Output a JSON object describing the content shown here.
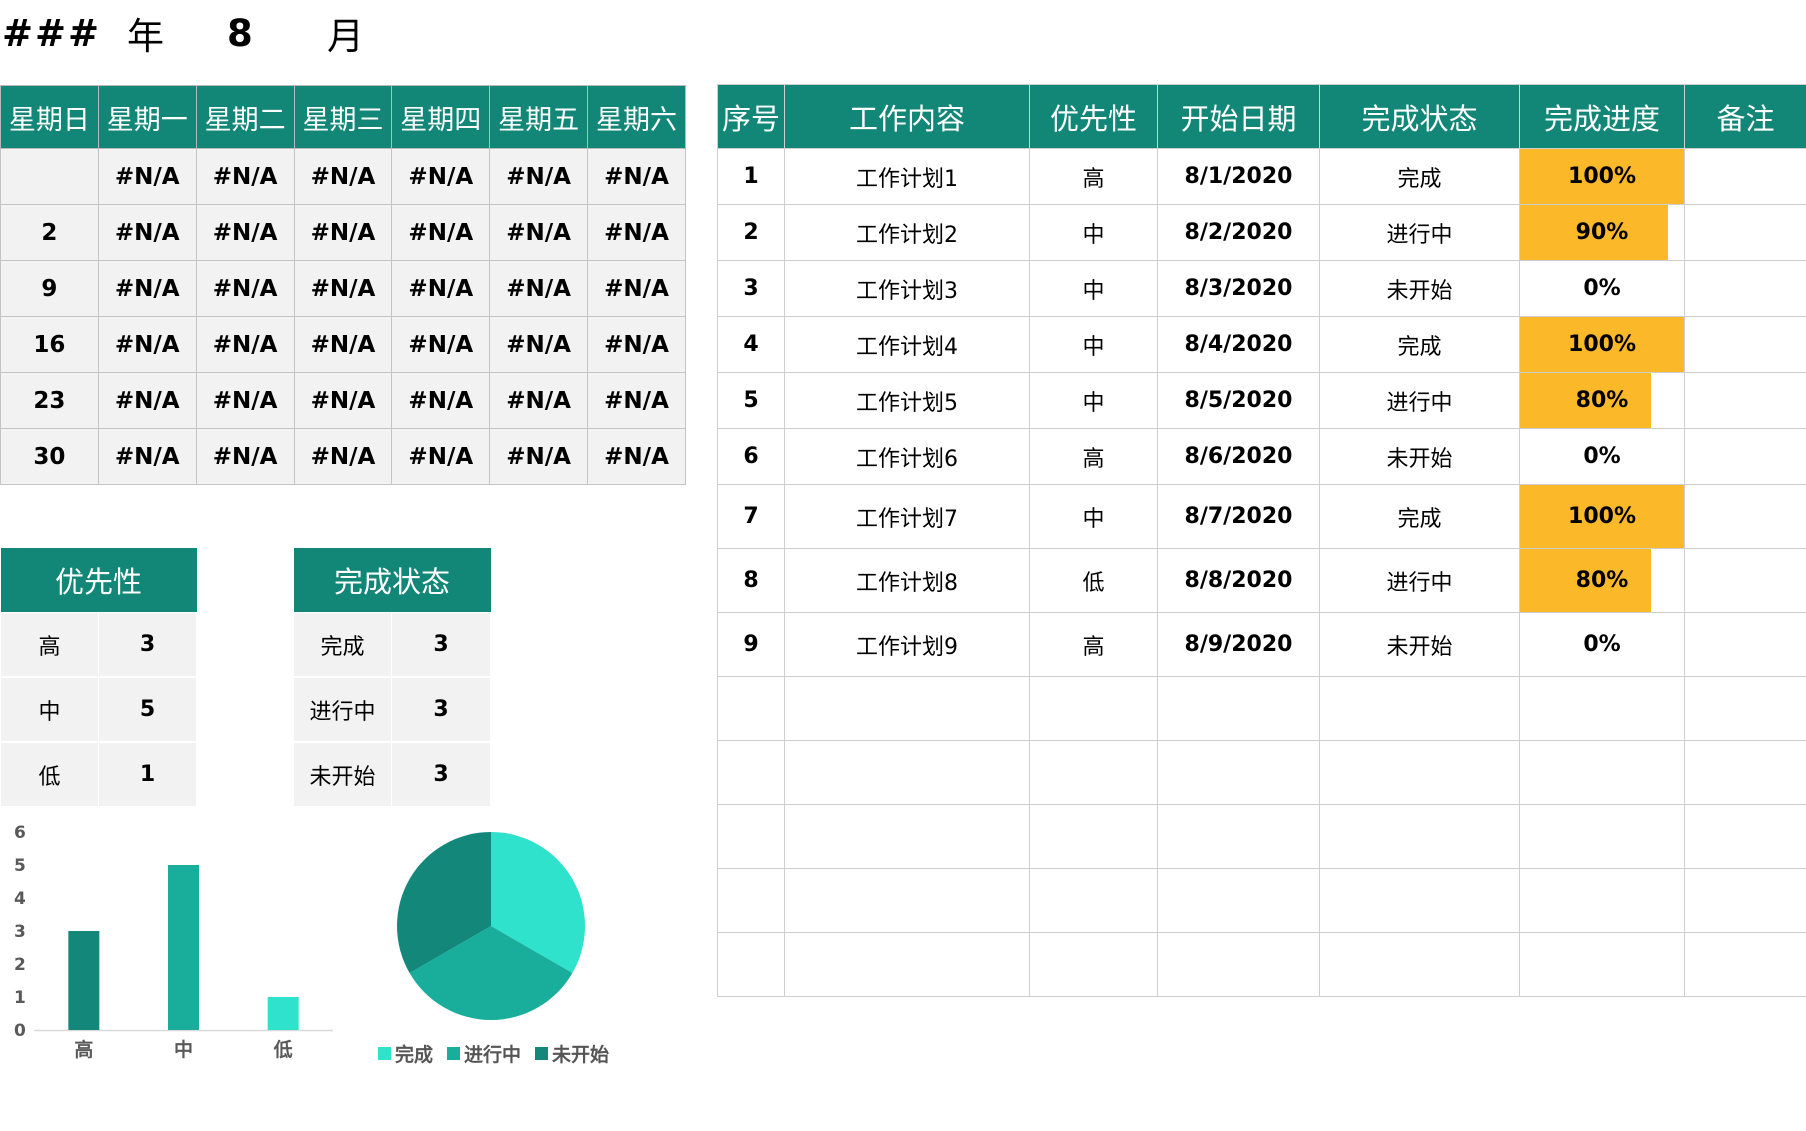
{
  "header": {
    "year": "###",
    "year_label": "年",
    "month": "8",
    "month_label": "月"
  },
  "calendar": {
    "weekdays": [
      "星期日",
      "星期一",
      "星期二",
      "星期三",
      "星期四",
      "星期五",
      "星期六"
    ],
    "rows": [
      [
        "",
        "#N/A",
        "#N/A",
        "#N/A",
        "#N/A",
        "#N/A",
        "#N/A"
      ],
      [
        "2",
        "#N/A",
        "#N/A",
        "#N/A",
        "#N/A",
        "#N/A",
        "#N/A"
      ],
      [
        "9",
        "#N/A",
        "#N/A",
        "#N/A",
        "#N/A",
        "#N/A",
        "#N/A"
      ],
      [
        "16",
        "#N/A",
        "#N/A",
        "#N/A",
        "#N/A",
        "#N/A",
        "#N/A"
      ],
      [
        "23",
        "#N/A",
        "#N/A",
        "#N/A",
        "#N/A",
        "#N/A",
        "#N/A"
      ],
      [
        "30",
        "#N/A",
        "#N/A",
        "#N/A",
        "#N/A",
        "#N/A",
        "#N/A"
      ]
    ]
  },
  "tasks": {
    "headers": [
      "序号",
      "工作内容",
      "优先性",
      "开始日期",
      "完成状态",
      "完成进度",
      "备注"
    ],
    "rows": [
      {
        "id": "1",
        "name": "工作计划1",
        "priority": "高",
        "date": "8/1/2020",
        "status": "完成",
        "progress": "100%",
        "progress_value": 1.0,
        "note": ""
      },
      {
        "id": "2",
        "name": "工作计划2",
        "priority": "中",
        "date": "8/2/2020",
        "status": "进行中",
        "progress": "90%",
        "progress_value": 0.9,
        "note": ""
      },
      {
        "id": "3",
        "name": "工作计划3",
        "priority": "中",
        "date": "8/3/2020",
        "status": "未开始",
        "progress": "0%",
        "progress_value": 0,
        "note": ""
      },
      {
        "id": "4",
        "name": "工作计划4",
        "priority": "中",
        "date": "8/4/2020",
        "status": "完成",
        "progress": "100%",
        "progress_value": 1.0,
        "note": ""
      },
      {
        "id": "5",
        "name": "工作计划5",
        "priority": "中",
        "date": "8/5/2020",
        "status": "进行中",
        "progress": "80%",
        "progress_value": 0.8,
        "note": ""
      },
      {
        "id": "6",
        "name": "工作计划6",
        "priority": "高",
        "date": "8/6/2020",
        "status": "未开始",
        "progress": "0%",
        "progress_value": 0,
        "note": ""
      },
      {
        "id": "7",
        "name": "工作计划7",
        "priority": "中",
        "date": "8/7/2020",
        "status": "完成",
        "progress": "100%",
        "progress_value": 1.0,
        "note": ""
      },
      {
        "id": "8",
        "name": "工作计划8",
        "priority": "低",
        "date": "8/8/2020",
        "status": "进行中",
        "progress": "80%",
        "progress_value": 0.8,
        "note": ""
      },
      {
        "id": "9",
        "name": "工作计划9",
        "priority": "高",
        "date": "8/9/2020",
        "status": "未开始",
        "progress": "0%",
        "progress_value": 0,
        "note": ""
      }
    ],
    "empty_rows": 5,
    "progress_color": "#fbb829"
  },
  "priority_summary": {
    "header": "优先性",
    "rows": [
      {
        "label": "高",
        "value": "3"
      },
      {
        "label": "中",
        "value": "5"
      },
      {
        "label": "低",
        "value": "1"
      }
    ]
  },
  "status_summary": {
    "header": "完成状态",
    "rows": [
      {
        "label": "完成",
        "value": "3"
      },
      {
        "label": "进行中",
        "value": "3"
      },
      {
        "label": "未开始",
        "value": "3"
      }
    ]
  },
  "colors": {
    "header_teal": "#128777",
    "dark_teal": "#12877a",
    "mid_teal": "#19ae9c",
    "light_teal": "#2ee2cc"
  },
  "chart_data": [
    {
      "type": "bar",
      "categories": [
        "高",
        "中",
        "低"
      ],
      "values": [
        3,
        5,
        1
      ],
      "ylim": [
        0,
        6
      ],
      "yticks": [
        0,
        1,
        2,
        3,
        4,
        5,
        6
      ],
      "colors": [
        "#12877a",
        "#19ae9c",
        "#2ee2cc"
      ],
      "grid": false
    },
    {
      "type": "pie",
      "categories": [
        "完成",
        "进行中",
        "未开始"
      ],
      "values": [
        3,
        3,
        3
      ],
      "colors": [
        "#2ee2cc",
        "#19ae9c",
        "#12877a"
      ],
      "legend": "bottom"
    }
  ]
}
